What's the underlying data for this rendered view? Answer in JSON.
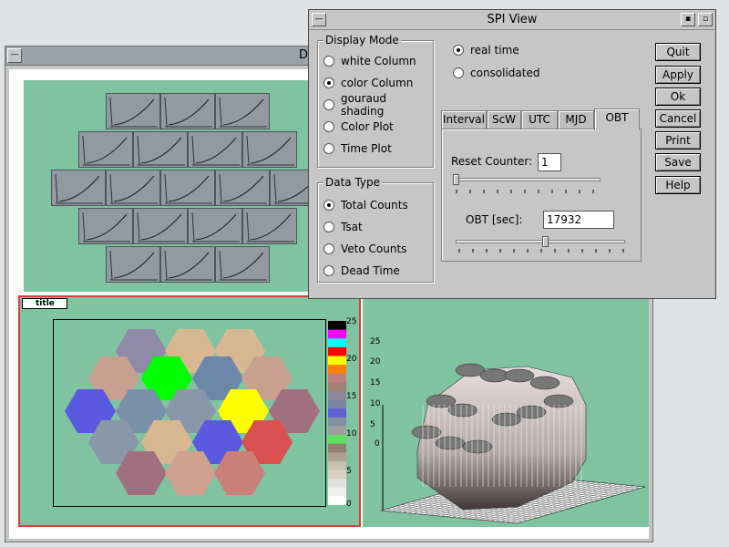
{
  "back_window": {
    "title": "D",
    "hexmap_title": "title"
  },
  "colorbar_ticks": [
    "25",
    "20",
    "15",
    "10",
    "5",
    "0"
  ],
  "zaxis_ticks": [
    "25",
    "20",
    "15",
    "10",
    "5",
    "0"
  ],
  "dialog": {
    "title": "SPI View",
    "display_mode": {
      "label": "Display Mode",
      "options": [
        "white Column",
        "color Column",
        "gouraud shading",
        "Color Plot",
        "Time Plot"
      ],
      "selected": "color Column"
    },
    "data_type": {
      "label": "Data Type",
      "options": [
        "Total Counts",
        "Tsat",
        "Veto Counts",
        "Dead Time"
      ],
      "selected": "Total Counts"
    },
    "mode": {
      "options": [
        "real time",
        "consolidated"
      ],
      "selected": "real time"
    },
    "tabs": [
      "Interval",
      "ScW",
      "UTC",
      "MJD",
      "OBT"
    ],
    "active_tab": "OBT",
    "reset_counter": {
      "label": "Reset Counter:",
      "value": "1"
    },
    "obt": {
      "label": "OBT  [sec]:",
      "value": "17932"
    },
    "buttons": [
      "Quit",
      "Apply",
      "Ok",
      "Cancel",
      "Print",
      "Save",
      "Help"
    ]
  },
  "colors": {
    "panel_green": "#80c3a0",
    "dialog_gray": "#c6c6c6",
    "hex_green": "#00ff00",
    "hex_yellow": "#ffff00",
    "hex_blue": "#5a5ae0",
    "hex_red": "#d85050"
  }
}
